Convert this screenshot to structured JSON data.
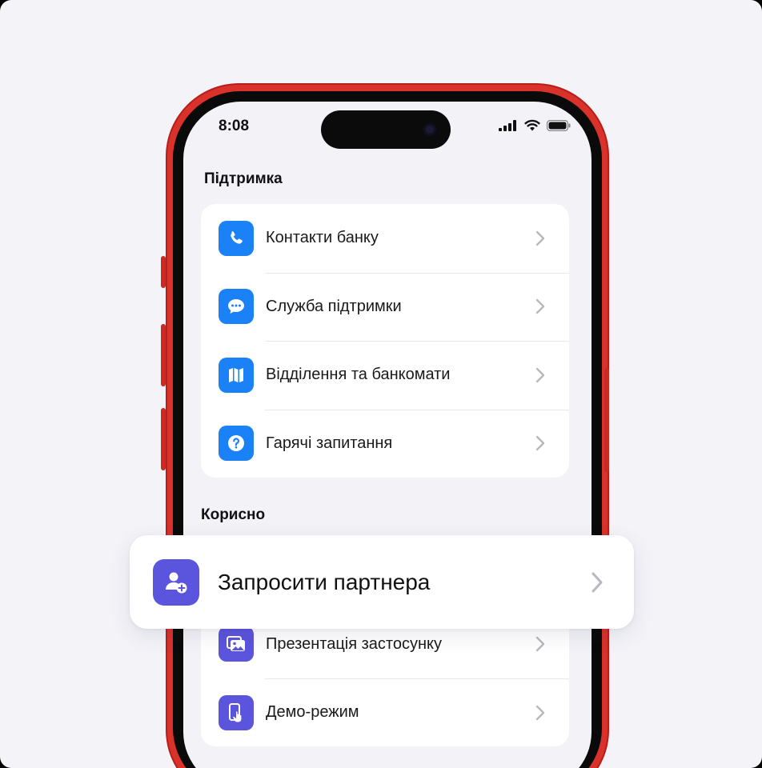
{
  "status_bar": {
    "time": "8:08"
  },
  "sections": {
    "support": {
      "title": "Підтримка",
      "items": [
        {
          "label": "Контакти банку",
          "icon": "phone-icon"
        },
        {
          "label": "Служба підтримки",
          "icon": "chat-bubble-icon"
        },
        {
          "label": "Відділення та банкомати",
          "icon": "map-icon"
        },
        {
          "label": "Гарячі запитання",
          "icon": "question-icon"
        }
      ]
    },
    "useful": {
      "title": "Корисно",
      "items": [
        {
          "label": "Презентація застосунку",
          "icon": "gallery-icon"
        },
        {
          "label": "Демо-режим",
          "icon": "phone-tap-icon"
        }
      ]
    }
  },
  "featured": {
    "label": "Запросити партнера",
    "icon": "add-user-icon"
  },
  "colors": {
    "phone_frame": "#d9322b",
    "support_icon": "#1a82f6",
    "useful_icon": "#5b54dd",
    "background": "#f3f3f8"
  }
}
